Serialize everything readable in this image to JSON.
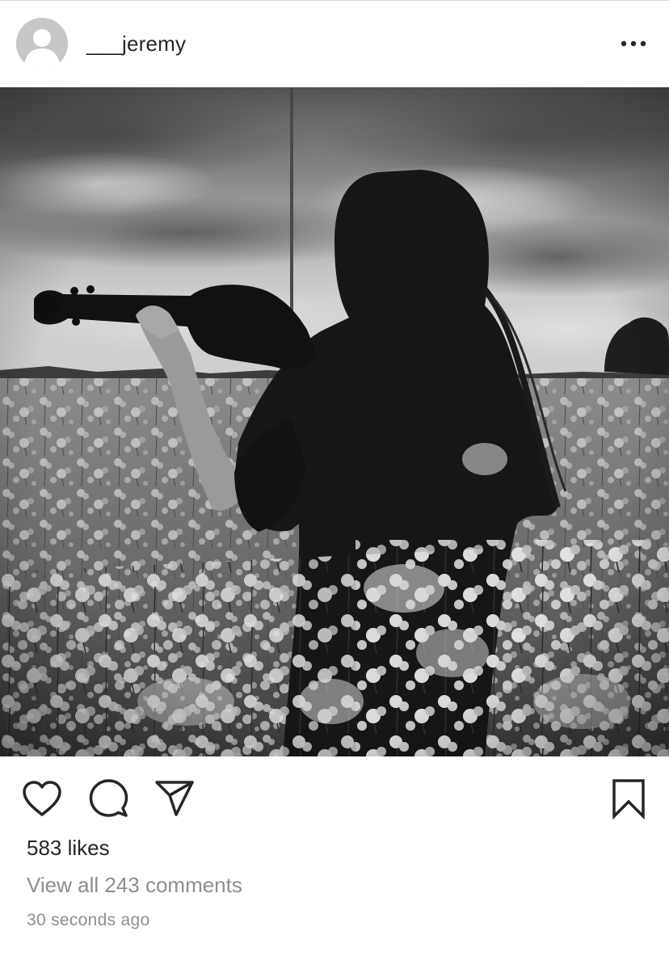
{
  "post": {
    "username": "___jeremy",
    "likes_text": "583 likes",
    "comments_link": "View all 243 comments",
    "timestamp": "30 seconds ago"
  },
  "icons": {
    "avatar": "default-avatar-icon",
    "more": "more-options-icon",
    "like": "heart-icon",
    "comment": "comment-icon",
    "share": "paper-plane-icon",
    "save": "bookmark-icon"
  },
  "colors": {
    "text": "#262626",
    "secondary_text": "#8e8e8e",
    "avatar_bg": "#c7c7c7",
    "divider": "#dbdbdb"
  }
}
